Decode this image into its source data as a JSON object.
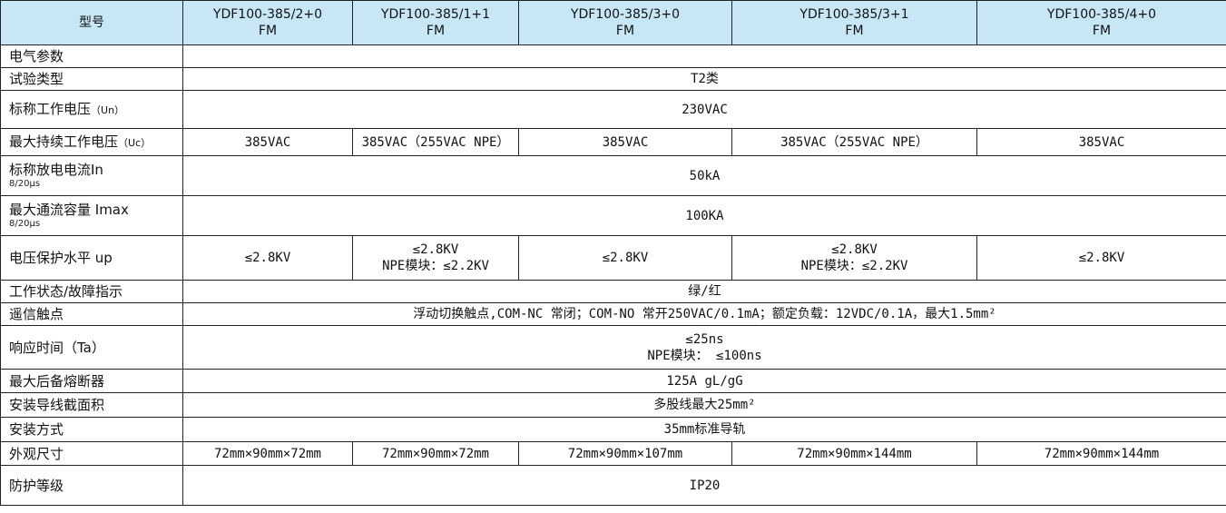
{
  "header": {
    "label": "型号",
    "models": [
      {
        "line1": "YDF100-385/2+0",
        "line2": "FM"
      },
      {
        "line1": "YDF100-385/1+1",
        "line2": "FM"
      },
      {
        "line1": "YDF100-385/3+0",
        "line2": "FM"
      },
      {
        "line1": "YDF100-385/3+1",
        "line2": "FM"
      },
      {
        "line1": "YDF100-385/4+0",
        "line2": "FM"
      }
    ]
  },
  "rows": {
    "electrical": {
      "label": "电气参数"
    },
    "test_type": {
      "label": "试验类型",
      "value": "T2类"
    },
    "un": {
      "label": "标称工作电压",
      "label_suffix": "（Un）",
      "value": "230VAC"
    },
    "uc": {
      "label": "最大持续工作电压",
      "label_suffix": "（Uc）",
      "values": [
        "385VAC",
        "385VAC（255VAC NPE）",
        "385VAC",
        "385VAC（255VAC NPE）",
        "385VAC"
      ]
    },
    "in": {
      "label": "标称放电电流In",
      "sub": "8/20μs",
      "value": "50kA"
    },
    "imax": {
      "label": "最大通流容量 Imax",
      "sub": "8/20μs",
      "value": "100KA"
    },
    "up": {
      "label": "电压保护水平 up",
      "values": [
        {
          "line1": "≤2.8KV",
          "line2": ""
        },
        {
          "line1": "≤2.8KV",
          "line2": "NPE模块：≤2.2KV"
        },
        {
          "line1": "≤2.8KV",
          "line2": ""
        },
        {
          "line1": "≤2.8KV",
          "line2": "NPE模块：≤2.2KV"
        },
        {
          "line1": "≤2.8KV",
          "line2": ""
        }
      ]
    },
    "status": {
      "label": "工作状态/故障指示",
      "value": "绿/红"
    },
    "remote": {
      "label": "遥信触点",
      "value": "浮动切换触点,COM-NC 常闭；COM-NO 常开250VAC/0.1mA；额定负载：12VDC/0.1A，最大1.5mm²"
    },
    "ta": {
      "label": "响应时间（Ta）",
      "line1": "≤25ns",
      "line2": "NPE模块： ≤100ns"
    },
    "fuse": {
      "label": "最大后备熔断器",
      "value": "125A gL/gG"
    },
    "wire": {
      "label": "安装导线截面积",
      "value": "多股线最大25mm²"
    },
    "mount": {
      "label": "安装方式",
      "value": "35mm标准导轨"
    },
    "dims": {
      "label": "外观尺寸",
      "values": [
        "72mm×90mm×72mm",
        "72mm×90mm×72mm",
        "72mm×90mm×107mm",
        "72mm×90mm×144mm",
        "72mm×90mm×144mm"
      ]
    },
    "ip": {
      "label": "防护等级",
      "value": "IP20"
    }
  },
  "colors": {
    "header_bg": "#c8e7f6",
    "border": "#222222"
  }
}
